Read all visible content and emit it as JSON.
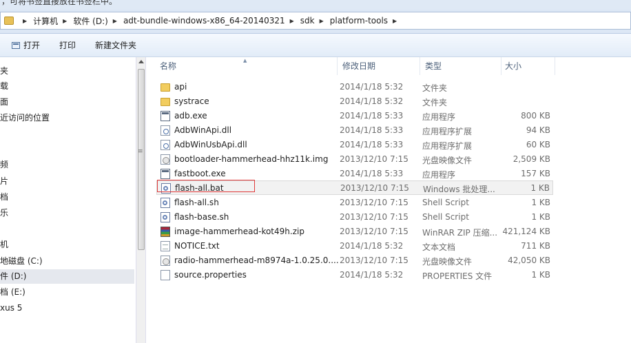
{
  "top_hint": "，可将书签直接放在书签栏中。",
  "address": {
    "crumbs": [
      "计算机",
      "软件 (D:)",
      "adt-bundle-windows-x86_64-20140321",
      "sdk",
      "platform-tools"
    ]
  },
  "toolbar": {
    "open_label": "打开",
    "print_label": "打印",
    "new_folder_label": "新建文件夹"
  },
  "nav": {
    "items": [
      "夹",
      "载",
      "面",
      "近访问的位置",
      "频",
      "片",
      "档",
      "乐",
      "机",
      "地磁盘 (C:)",
      "件 (D:)",
      "档 (E:)",
      "xus 5"
    ]
  },
  "columns": {
    "name": "名称",
    "date": "修改日期",
    "type": "类型",
    "size": "大小"
  },
  "files": [
    {
      "name": "api",
      "date": "2014/1/18 5:32",
      "type": "文件夹",
      "size": "",
      "icon": "folder-icon"
    },
    {
      "name": "systrace",
      "date": "2014/1/18 5:32",
      "type": "文件夹",
      "size": "",
      "icon": "folder-icon"
    },
    {
      "name": "adb.exe",
      "date": "2014/1/18 5:33",
      "type": "应用程序",
      "size": "800 KB",
      "icon": "exe-icon"
    },
    {
      "name": "AdbWinApi.dll",
      "date": "2014/1/18 5:33",
      "type": "应用程序扩展",
      "size": "94 KB",
      "icon": "dll-icon"
    },
    {
      "name": "AdbWinUsbApi.dll",
      "date": "2014/1/18 5:33",
      "type": "应用程序扩展",
      "size": "60 KB",
      "icon": "dll-icon"
    },
    {
      "name": "bootloader-hammerhead-hhz11k.img",
      "date": "2013/12/10 7:15",
      "type": "光盘映像文件",
      "size": "2,509 KB",
      "icon": "disc-image-icon"
    },
    {
      "name": "fastboot.exe",
      "date": "2014/1/18 5:33",
      "type": "应用程序",
      "size": "157 KB",
      "icon": "exe-icon"
    },
    {
      "name": "flash-all.bat",
      "date": "2013/12/10 7:15",
      "type": "Windows 批处理...",
      "size": "1 KB",
      "icon": "batch-file-icon"
    },
    {
      "name": "flash-all.sh",
      "date": "2013/12/10 7:15",
      "type": "Shell Script",
      "size": "1 KB",
      "icon": "shell-script-icon"
    },
    {
      "name": "flash-base.sh",
      "date": "2013/12/10 7:15",
      "type": "Shell Script",
      "size": "1 KB",
      "icon": "shell-script-icon"
    },
    {
      "name": "image-hammerhead-kot49h.zip",
      "date": "2013/12/10 7:15",
      "type": "WinRAR ZIP 压缩...",
      "size": "421,124 KB",
      "icon": "winrar-zip-icon"
    },
    {
      "name": "NOTICE.txt",
      "date": "2014/1/18 5:32",
      "type": "文本文档",
      "size": "711 KB",
      "icon": "text-file-icon"
    },
    {
      "name": "radio-hammerhead-m8974a-1.0.25.0....",
      "date": "2013/12/10 7:15",
      "type": "光盘映像文件",
      "size": "42,050 KB",
      "icon": "disc-image-icon"
    },
    {
      "name": "source.properties",
      "date": "2014/1/18 5:32",
      "type": "PROPERTIES 文件",
      "size": "1 KB",
      "icon": "file-icon"
    }
  ]
}
